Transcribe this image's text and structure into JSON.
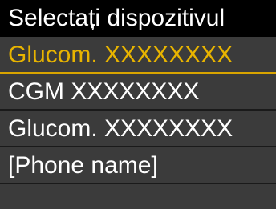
{
  "header": {
    "title": "Selectați dispozitivul"
  },
  "devices": [
    {
      "label": "Glucom. XXXXXXXX",
      "selected": true
    },
    {
      "label": "CGM XXXXXXXX",
      "selected": false
    },
    {
      "label": "Glucom. XXXXXXXX",
      "selected": false
    },
    {
      "label": "[Phone name]",
      "selected": false
    }
  ],
  "colors": {
    "background": "#3b3b3b",
    "header_background": "#000000",
    "text": "#ffffff",
    "selected_text": "#e8b400",
    "selected_underline": "#d9a400"
  }
}
